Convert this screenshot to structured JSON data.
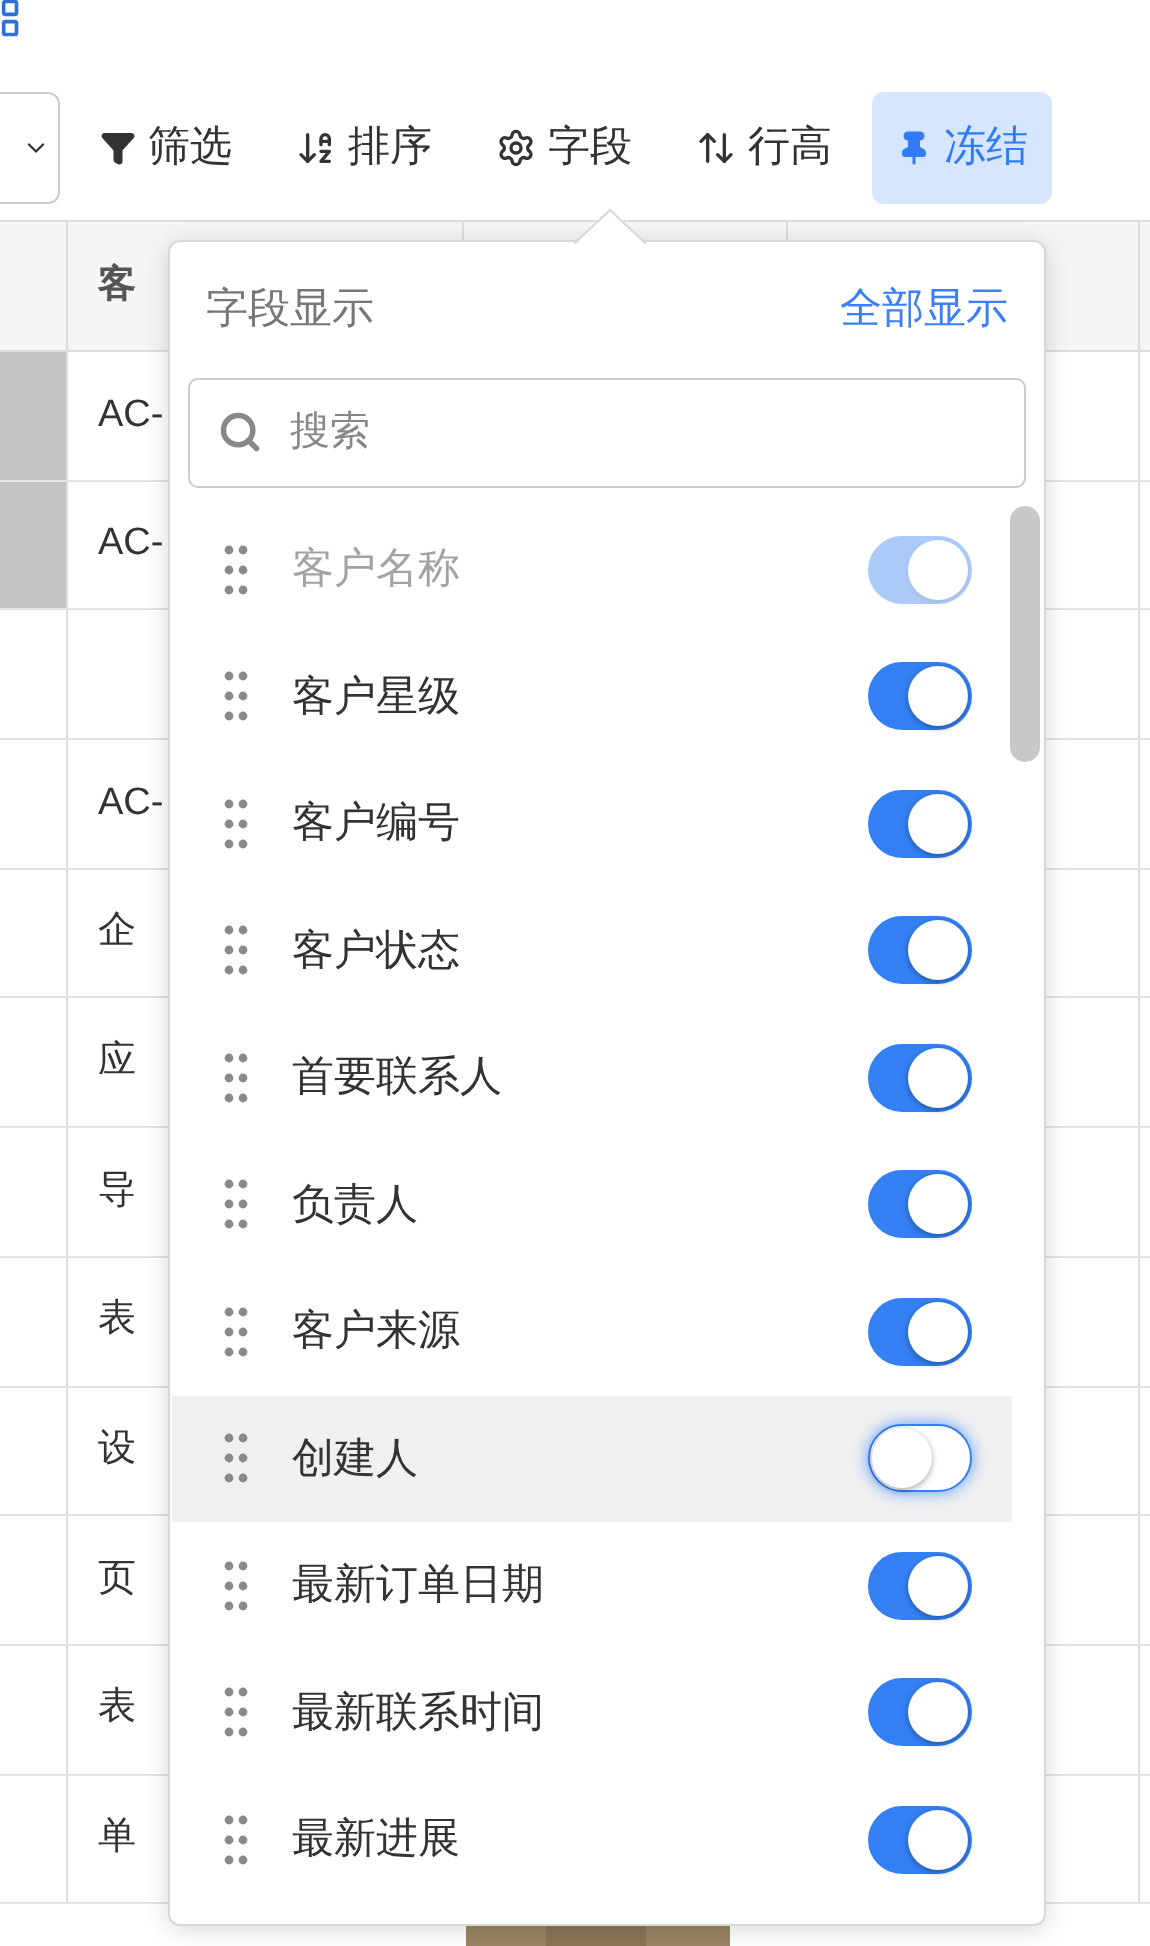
{
  "toolbar": {
    "buttons": [
      {
        "label": "筛选",
        "kind": "filter",
        "selected": false
      },
      {
        "label": "排序",
        "kind": "sort",
        "selected": false
      },
      {
        "label": "字段",
        "kind": "fields",
        "selected": false
      },
      {
        "label": "行高",
        "kind": "height",
        "selected": false
      },
      {
        "label": "冻结",
        "kind": "pin",
        "selected": true
      }
    ]
  },
  "table": {
    "header": "客",
    "rows": [
      {
        "marked": true,
        "text": "AC-"
      },
      {
        "marked": true,
        "text": "AC-"
      },
      {
        "marked": false
      },
      {
        "marked": false,
        "text": "AC-"
      },
      {
        "marked": false,
        "text": "企"
      },
      {
        "marked": false,
        "text": "应"
      },
      {
        "marked": false,
        "text": "导"
      },
      {
        "marked": false,
        "text": "表"
      },
      {
        "marked": false,
        "text": "设"
      },
      {
        "marked": false,
        "text": "页"
      },
      {
        "marked": false,
        "text": "表"
      },
      {
        "marked": false,
        "text": "单"
      }
    ]
  },
  "popover": {
    "title": "字段显示",
    "show_all": "全部显示",
    "search": {
      "placeholder": "搜索"
    },
    "fields": [
      {
        "label": "客户名称",
        "on": true,
        "disabled": true,
        "highlighted": false
      },
      {
        "label": "客户星级",
        "on": true,
        "disabled": false,
        "highlighted": false
      },
      {
        "label": "客户编号",
        "on": true,
        "disabled": false,
        "highlighted": false
      },
      {
        "label": "客户状态",
        "on": true,
        "disabled": false,
        "highlighted": false
      },
      {
        "label": "首要联系人",
        "on": true,
        "disabled": false,
        "highlighted": false
      },
      {
        "label": "负责人",
        "on": true,
        "disabled": false,
        "highlighted": false
      },
      {
        "label": "客户来源",
        "on": true,
        "disabled": false,
        "highlighted": false
      },
      {
        "label": "创建人",
        "on": false,
        "disabled": false,
        "highlighted": true
      },
      {
        "label": "最新订单日期",
        "on": true,
        "disabled": false,
        "highlighted": false
      },
      {
        "label": "最新联系时间",
        "on": true,
        "disabled": false,
        "highlighted": false
      },
      {
        "label": "最新进展",
        "on": true,
        "disabled": false,
        "highlighted": false
      }
    ]
  }
}
